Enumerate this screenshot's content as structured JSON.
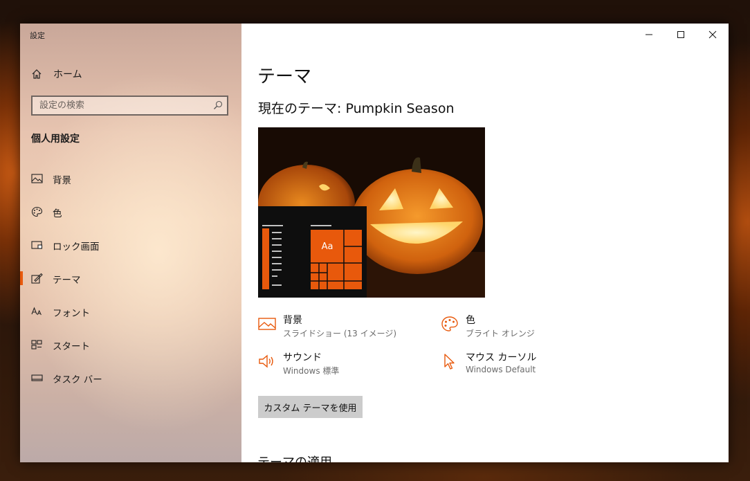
{
  "window": {
    "title": "設定"
  },
  "sidebar": {
    "home_label": "ホーム",
    "search_placeholder": "設定の検索",
    "section_heading": "個人用設定",
    "items": [
      {
        "label": "背景",
        "icon": "picture-icon"
      },
      {
        "label": "色",
        "icon": "palette-icon"
      },
      {
        "label": "ロック画面",
        "icon": "lock-screen-icon"
      },
      {
        "label": "テーマ",
        "icon": "theme-icon",
        "active": true
      },
      {
        "label": "フォント",
        "icon": "font-icon"
      },
      {
        "label": "スタート",
        "icon": "start-icon"
      },
      {
        "label": "タスク バー",
        "icon": "taskbar-icon"
      }
    ]
  },
  "main": {
    "page_title": "テーマ",
    "current_theme": "現在のテーマ: Pumpkin Season",
    "preview_tile_text": "Aa",
    "properties": [
      {
        "title": "背景",
        "subtitle": "スライドショー (13 イメージ)",
        "icon": "picture-icon"
      },
      {
        "title": "色",
        "subtitle": "ブライト オレンジ",
        "icon": "palette-icon"
      },
      {
        "title": "サウンド",
        "subtitle": "Windows 標準",
        "icon": "speaker-icon"
      },
      {
        "title": "マウス カーソル",
        "subtitle": "Windows Default",
        "icon": "cursor-icon"
      }
    ],
    "custom_button": "カスタム テーマを使用",
    "apply_heading": "テーマの適用"
  },
  "colors": {
    "accent": "#e8590c"
  }
}
